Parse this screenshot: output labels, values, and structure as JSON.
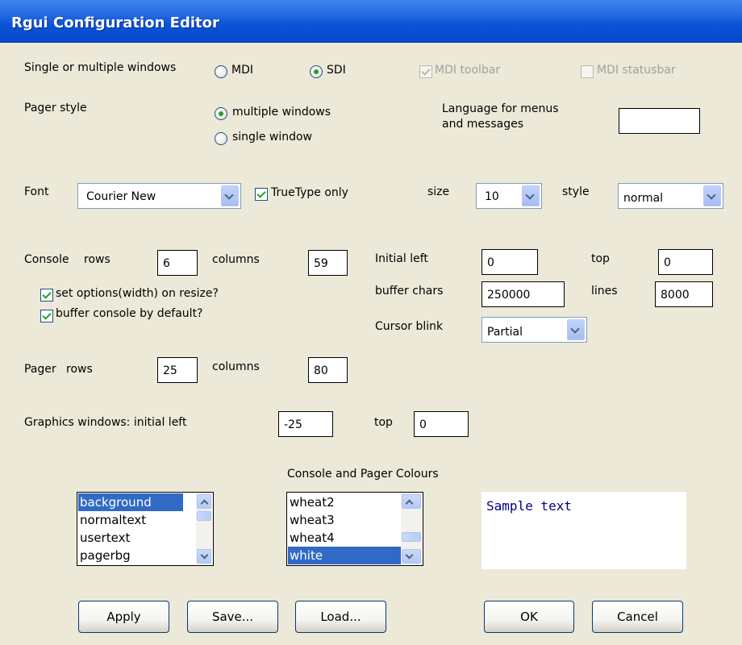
{
  "window": {
    "title": "Rgui Configuration Editor"
  },
  "windows_mode": {
    "label": "Single or multiple windows",
    "options": [
      "MDI",
      "SDI"
    ],
    "selected": "SDI",
    "mdi_toolbar": {
      "label": "MDI toolbar",
      "checked": true,
      "enabled": false
    },
    "mdi_statusbar": {
      "label": "MDI statusbar",
      "checked": false,
      "enabled": false
    }
  },
  "pager_style": {
    "label": "Pager style",
    "options": [
      "multiple windows",
      "single window"
    ],
    "selected": "multiple windows"
  },
  "language": {
    "label_line1": "Language for menus",
    "label_line2": "and messages",
    "value": ""
  },
  "font": {
    "label": "Font",
    "family": "Courier New",
    "truetype_only_label": "TrueType only",
    "truetype_only": true,
    "size_label": "size",
    "size": "10",
    "style_label": "style",
    "style": "normal"
  },
  "console": {
    "label": "Console",
    "rows_label": "rows",
    "rows": "6",
    "columns_label": "columns",
    "columns": "59",
    "set_options_label": "set options(width) on resize?",
    "set_options": true,
    "buffer_label": "buffer console by default?",
    "buffer": true,
    "initial_left_label": "Initial left",
    "initial_left": "0",
    "top_label": "top",
    "top": "0",
    "buffer_chars_label": "buffer chars",
    "buffer_chars": "250000",
    "lines_label": "lines",
    "lines": "8000",
    "cursor_blink_label": "Cursor blink",
    "cursor_blink": "Partial"
  },
  "pager": {
    "label": "Pager",
    "rows_label": "rows",
    "rows": "25",
    "columns_label": "columns",
    "columns": "80"
  },
  "graphics": {
    "label": "Graphics windows: initial left",
    "left": "-25",
    "top_label": "top",
    "top": "0"
  },
  "colours": {
    "title": "Console and Pager Colours",
    "elements": [
      "background",
      "normaltext",
      "usertext",
      "pagerbg"
    ],
    "selected_element": "background",
    "colours": [
      "wheat2",
      "wheat3",
      "wheat4",
      "white"
    ],
    "selected_colour": "white",
    "sample_text": "Sample text"
  },
  "buttons": {
    "apply": "Apply",
    "save": "Save...",
    "load": "Load...",
    "ok": "OK",
    "cancel": "Cancel"
  }
}
